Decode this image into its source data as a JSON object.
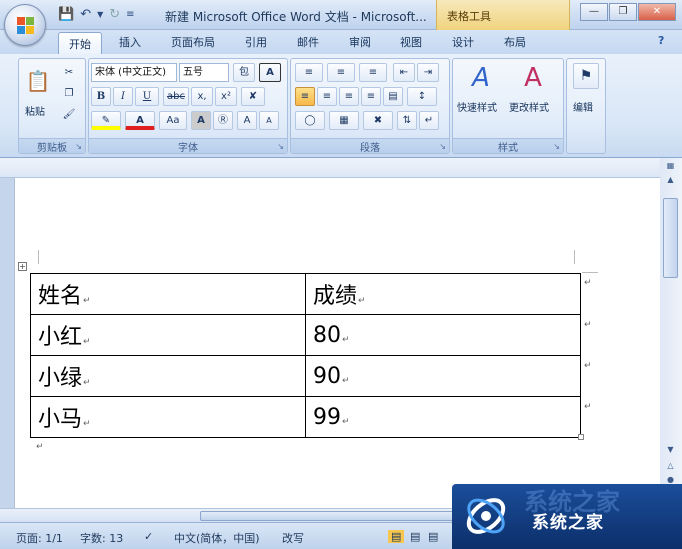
{
  "window": {
    "title": "新建 Microsoft Office Word 文档 - Microsoft...",
    "context_tab": "表格工具",
    "help_glyph": "?"
  },
  "tabs": [
    "开始",
    "插入",
    "页面布局",
    "引用",
    "邮件",
    "审阅",
    "视图",
    "设计",
    "布局"
  ],
  "ribbon": {
    "clipboard": {
      "label": "剪贴板",
      "paste": "粘贴"
    },
    "font": {
      "label": "字体",
      "font_name": "宋体 (中文正文)",
      "font_size": "五号",
      "bold": "B",
      "italic": "I",
      "underline": "U",
      "strike": "abc",
      "subscript": "x,",
      "superscript": "x²",
      "font_color": "A",
      "case": "Aa",
      "grow": "A",
      "shrink": "A"
    },
    "paragraph": {
      "label": "段落"
    },
    "styles": {
      "label": "样式",
      "quick": "快速样式",
      "change": "更改样式"
    },
    "editing": {
      "label": "编辑"
    }
  },
  "table": {
    "rows": [
      [
        "姓名",
        "成绩"
      ],
      [
        "小红",
        "80"
      ],
      [
        "小绿",
        "90"
      ],
      [
        "小马",
        "99"
      ]
    ]
  },
  "statusbar": {
    "page": "页面: 1/1",
    "words": "字数: 13",
    "language": "中文(简体，中国)",
    "mode": "改写"
  },
  "watermark": {
    "text": "系统之家"
  },
  "colors": {
    "accent": "#1b4e9a",
    "context_tab": "#efd37e",
    "ribbon_bg": "#d8e6f7"
  }
}
